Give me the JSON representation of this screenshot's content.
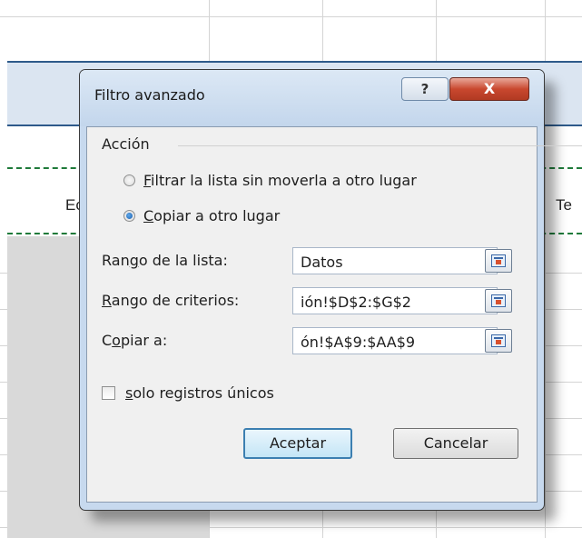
{
  "sheet": {
    "cells": [
      "Ec",
      "Te"
    ]
  },
  "dialog": {
    "title": "Filtro avanzado",
    "help_glyph": "?",
    "close_glyph": "X",
    "group_label": "Acción",
    "radios": [
      {
        "accel": "F",
        "label": "iltrar la lista sin moverla a otro lugar",
        "selected": false
      },
      {
        "accel": "C",
        "label": "opiar a otro lugar",
        "selected": true
      }
    ],
    "fields": [
      {
        "label_pre": "Ran",
        "accel": "g",
        "label_post": "o de la lista:",
        "value": "Datos"
      },
      {
        "label_pre": "",
        "accel": "R",
        "label_post": "ango de criterios:",
        "value": "ión!$D$2:$G$2"
      },
      {
        "label_pre": "C",
        "accel": "o",
        "label_post": "piar a:",
        "value": "ón!$A$9:$AA$9"
      }
    ],
    "checkbox": {
      "accel": "s",
      "label": "olo registros únicos",
      "checked": false
    },
    "ok_label": "Aceptar",
    "cancel_label": "Cancelar",
    "icons": {
      "collapse": "collapse-dialog-icon",
      "help": "help-icon",
      "close": "close-icon"
    }
  }
}
